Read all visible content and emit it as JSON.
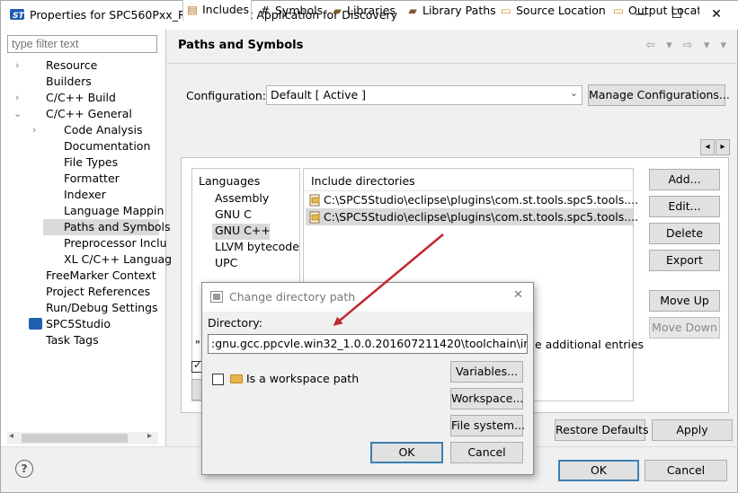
{
  "window": {
    "title": "Properties for SPC560Pxx_RLA STM Test Application for Discovery",
    "minimize": "—",
    "maximize": "☐",
    "close": "✕"
  },
  "left": {
    "filter_placeholder": "type filter text",
    "tree": [
      {
        "label": "Resource",
        "arrow": "›"
      },
      {
        "label": "Builders",
        "arrow": ""
      },
      {
        "label": "C/C++ Build",
        "arrow": "›"
      },
      {
        "label": "C/C++ General",
        "arrow": "⌄"
      },
      {
        "label": "Code Analysis",
        "arrow": "›"
      },
      {
        "label": "Documentation",
        "arrow": ""
      },
      {
        "label": "File Types",
        "arrow": ""
      },
      {
        "label": "Formatter",
        "arrow": ""
      },
      {
        "label": "Indexer",
        "arrow": ""
      },
      {
        "label": "Language Mappin",
        "arrow": ""
      },
      {
        "label": "Paths and Symbols",
        "arrow": ""
      },
      {
        "label": "Preprocessor Inclu",
        "arrow": ""
      },
      {
        "label": "XL C/C++ Languag",
        "arrow": ""
      },
      {
        "label": "FreeMarker Context",
        "arrow": ""
      },
      {
        "label": "Project References",
        "arrow": ""
      },
      {
        "label": "Run/Debug Settings",
        "arrow": ""
      },
      {
        "label": "SPC5Studio",
        "arrow": ""
      },
      {
        "label": "Task Tags",
        "arrow": ""
      }
    ]
  },
  "main": {
    "heading": "Paths and Symbols",
    "nav_icons": "⇦ ▾ ⇨ ▾ ▾",
    "configuration_label": "Configuration:",
    "configuration_value": "Default  [ Active ]",
    "manage_button": "Manage Configurations...",
    "tabs": [
      {
        "label": "Includes",
        "icon": "▤"
      },
      {
        "label": "Symbols",
        "icon": "#"
      },
      {
        "label": "Libraries",
        "icon": "▰"
      },
      {
        "label": "Library Paths",
        "icon": "▰"
      },
      {
        "label": "Source Location",
        "icon": "▭"
      },
      {
        "label": "Output Locati",
        "icon": "▭"
      }
    ],
    "tab_scroll_left": "◂",
    "tab_scroll_right": "▸",
    "languages_header": "Languages",
    "languages": [
      "Assembly",
      "GNU C",
      "GNU C++",
      "LLVM bytecode",
      "UPC"
    ],
    "include_header": "Include directories",
    "include_dirs": [
      "C:\\SPC5Studio\\eclipse\\plugins\\com.st.tools.spc5.tools....",
      "C:\\SPC5Studio\\eclipse\\plugins\\com.st.tools.spc5.tools...."
    ],
    "side_buttons": [
      "Add...",
      "Edit...",
      "Delete",
      "Export",
      "Move Up",
      "Move Down"
    ],
    "hint_prefix": "\"P",
    "hint_suffix": "e additional entries",
    "restore_defaults": "Restore Defaults",
    "apply": "Apply"
  },
  "footer": {
    "help": "?",
    "ok": "OK",
    "cancel": "Cancel"
  },
  "dialog": {
    "title": "Change directory path",
    "close": "✕",
    "directory_label": "Directory:",
    "directory_value": ":gnu.gcc.ppcvle.win32_1.0.0.201607211420\\toolchain\\include",
    "workspace_checkbox": "Is a workspace path",
    "variables": "Variables...",
    "workspace": "Workspace...",
    "file_system": "File system...",
    "ok": "OK",
    "cancel": "Cancel"
  },
  "colors": {
    "selection": "#d9d9d9",
    "focus_border": "#3c7fb1",
    "annotation_arrow": "#c0282d",
    "folder": "#e8b64a"
  }
}
